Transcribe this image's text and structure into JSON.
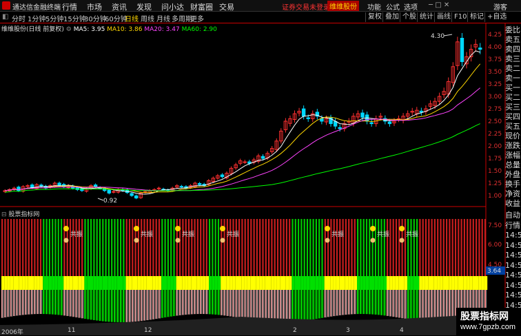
{
  "app": {
    "title": "通达信金融终端"
  },
  "menu": [
    "行情",
    "市场",
    "资讯",
    "发现",
    "问小达",
    "财富圈",
    "交易"
  ],
  "warning": "证券交易未登录",
  "stock_badge": "维维股份",
  "right_menu": [
    "功能",
    "公式",
    "选项",
    "游客"
  ],
  "period_tabs": [
    "分时",
    "1分钟",
    "5分钟",
    "15分钟",
    "30分钟",
    "60分钟",
    "日线",
    "周线",
    "月线",
    "多周期",
    "更多"
  ],
  "active_tab": "日线",
  "toolbar": [
    "复权",
    "叠加",
    "个股",
    "统计",
    "画线",
    "F10",
    "标记",
    "+自选"
  ],
  "main_legend": {
    "name": "维维股份(日线 前复权)",
    "ma5": "MA5: 3.95",
    "ma10": "MA10: 3.86",
    "ma20": "MA20: 3.47",
    "ma60": "MA60: 2.90"
  },
  "price_axis": [
    "4.25",
    "4.00",
    "3.75",
    "3.50",
    "3.25",
    "3.00",
    "2.75",
    "2.50",
    "2.25",
    "2.00",
    "1.75",
    "1.50",
    "1.25",
    "1.00"
  ],
  "annotations": {
    "high": "4.30",
    "low": "0.92"
  },
  "side_panel": [
    "委比",
    "卖五",
    "卖四",
    "卖三",
    "卖二",
    "卖一",
    "买一",
    "买二",
    "买三",
    "买四",
    "买五",
    "现价",
    "涨跌",
    "涨幅",
    "总量",
    "外盘",
    "换手",
    "净资",
    "收益"
  ],
  "indicator": {
    "header": "股票指标网",
    "axis": [
      "7.50",
      "6.00",
      "4.50"
    ],
    "current_value": "3.64",
    "label": "共振",
    "side": [
      "自动",
      "行情",
      "14:5",
      "14:5",
      "14:5",
      "14:5",
      "14:5",
      "14:5",
      "14:5",
      "14:5",
      "14:5",
      "14:5"
    ]
  },
  "x_ticks": [
    "2006年",
    "11",
    "12",
    "2",
    "3",
    "4"
  ],
  "watermark": {
    "title": "股票指标网",
    "url": "www.7gpzb.com"
  },
  "colors": {
    "up": "#ff3030",
    "down": "#00d8ff",
    "ma5": "#ffffff",
    "ma10": "#ffd700",
    "ma20": "#ff44ff",
    "ma60": "#00ff00"
  },
  "chart_data": {
    "type": "candlestick",
    "ylim": [
      0.92,
      4.3
    ],
    "closes": [
      1.1,
      1.12,
      1.15,
      1.1,
      1.18,
      1.2,
      1.16,
      1.22,
      1.18,
      1.15,
      1.2,
      1.25,
      1.21,
      1.18,
      1.2,
      1.15,
      1.12,
      1.1,
      1.14,
      1.2,
      1.18,
      1.15,
      1.1,
      1.05,
      1.08,
      1.12,
      1.1,
      1.06,
      1.0,
      0.95,
      1.05,
      1.08,
      1.1,
      1.12,
      1.15,
      1.12,
      1.1,
      1.15,
      1.2,
      1.18,
      1.15,
      1.2,
      1.25,
      1.22,
      1.2,
      1.3,
      1.35,
      1.4,
      1.38,
      1.45,
      1.55,
      1.62,
      1.7,
      1.68,
      1.65,
      1.72,
      1.8,
      1.75,
      1.85,
      1.95,
      2.1,
      2.3,
      2.5,
      2.55,
      2.65,
      2.7,
      2.6,
      2.55,
      2.65,
      2.6,
      2.5,
      2.55,
      2.45,
      2.4,
      2.35,
      2.45,
      2.5,
      2.6,
      2.65,
      2.58,
      2.5,
      2.45,
      2.55,
      2.6,
      2.5,
      2.45,
      2.5,
      2.55,
      2.6,
      2.65,
      2.7,
      2.72,
      2.68,
      2.75,
      2.85,
      2.9,
      3.0,
      3.1,
      3.3,
      3.6,
      4.1,
      3.7,
      3.8,
      3.95,
      4.05,
      3.95
    ]
  }
}
